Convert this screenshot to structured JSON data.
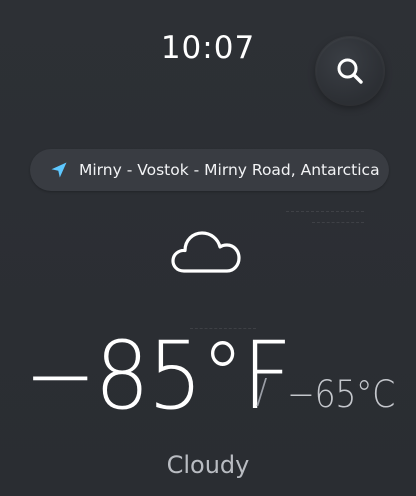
{
  "status": {
    "time": "10:07"
  },
  "header": {
    "search_icon": "search-icon"
  },
  "location": {
    "icon": "location-arrow-icon",
    "label": "Mirny - Vostok - Mirny Road, Antarctica",
    "icon_color": "#5ec8ff"
  },
  "weather": {
    "icon": "cloud-icon",
    "temperature_primary": "−85°F",
    "separator": "/",
    "temperature_secondary": "−65°C",
    "condition": "Cloudy"
  },
  "colors": {
    "background": "#2b2e33",
    "pill": "#393c42",
    "accent": "#5ec8ff"
  }
}
